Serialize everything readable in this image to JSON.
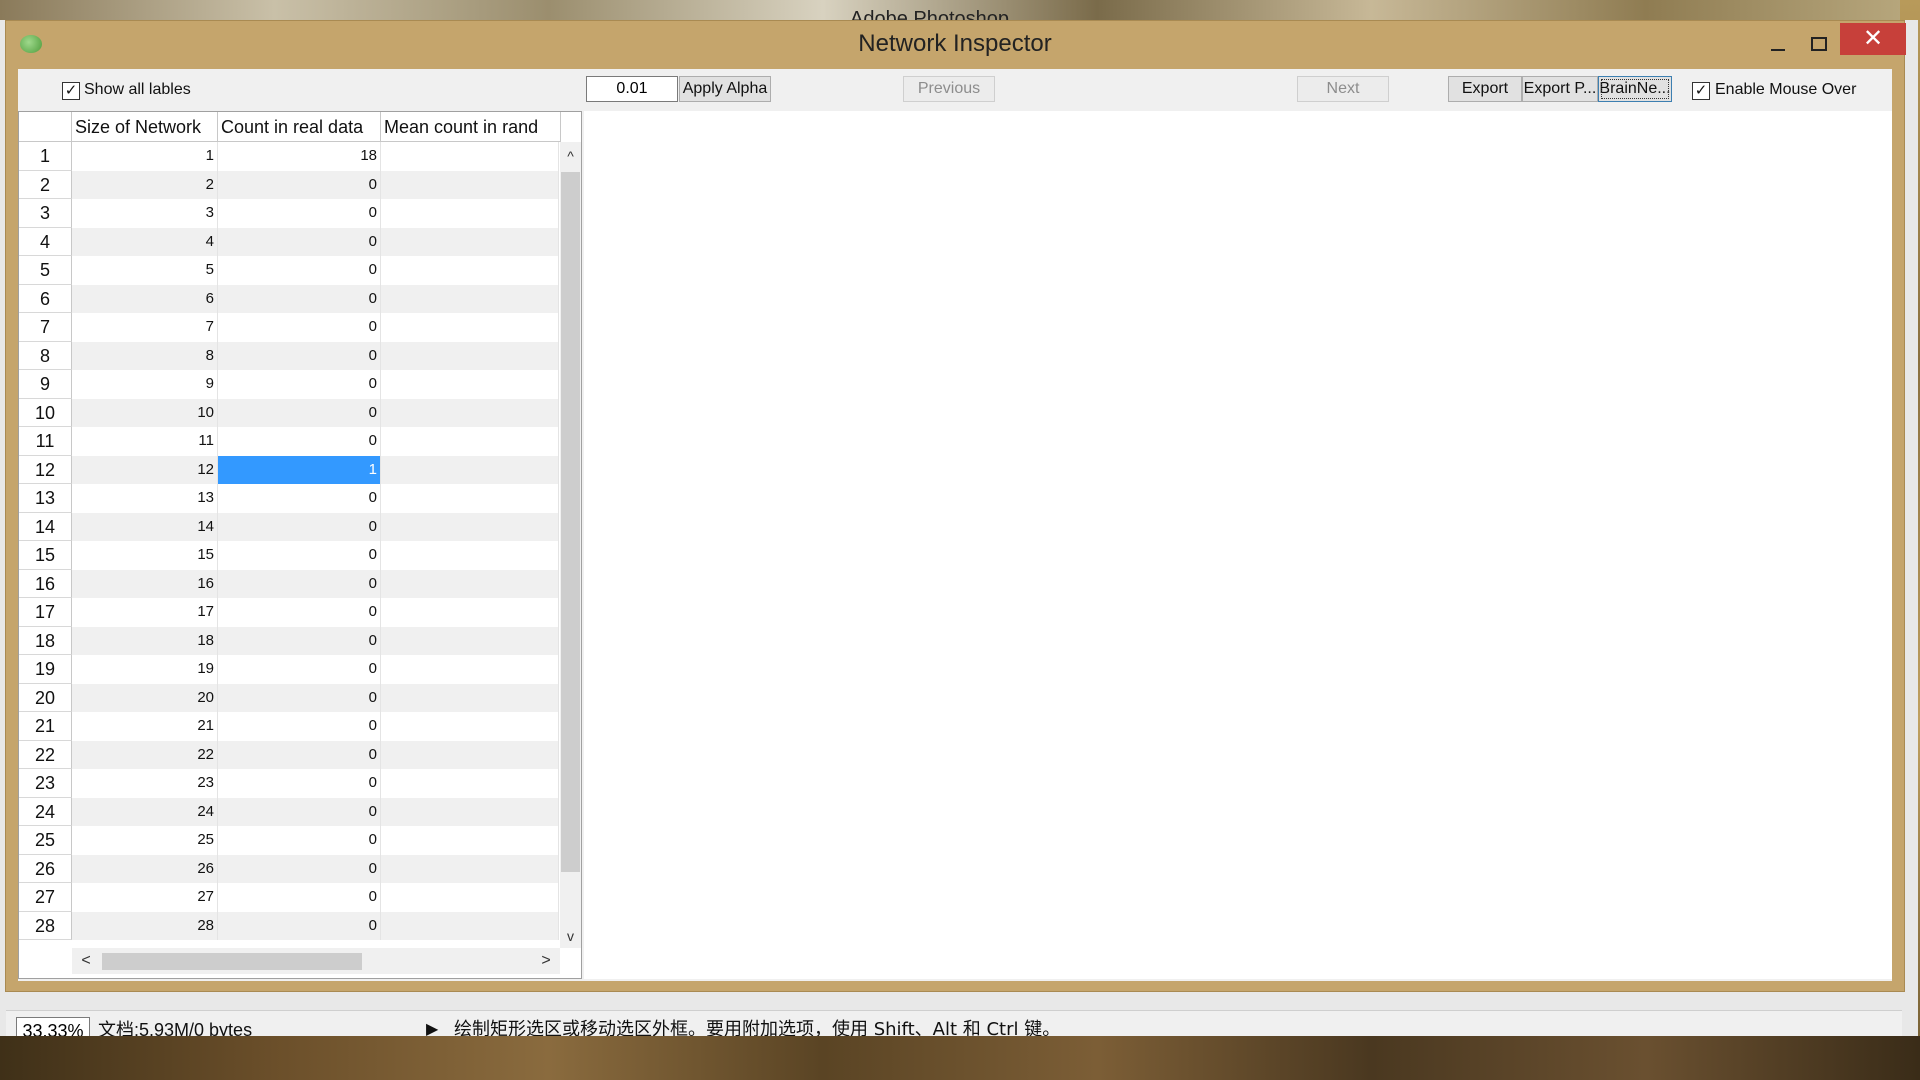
{
  "desktop": {
    "behind_title": "Adobe Photoshop"
  },
  "window": {
    "title": "Network Inspector",
    "close_glyph": "✕"
  },
  "toolbar": {
    "show_all_labels": {
      "label": "Show all lables",
      "checked": true
    },
    "alpha_value": "0.01",
    "apply_alpha": "Apply Alpha",
    "previous": "Previous",
    "next": "Next",
    "export": "Export",
    "export_p": "Export P...",
    "brainnet": "BrainNe...",
    "enable_mouse_over": {
      "label": "Enable Mouse Over",
      "checked": true
    },
    "check_glyph": "✓"
  },
  "table": {
    "columns": [
      "Size of Network",
      "Count in real data",
      "Mean count in rand"
    ],
    "rows": [
      {
        "n": "1",
        "size": "1",
        "count": "18"
      },
      {
        "n": "2",
        "size": "2",
        "count": "0"
      },
      {
        "n": "3",
        "size": "3",
        "count": "0"
      },
      {
        "n": "4",
        "size": "4",
        "count": "0"
      },
      {
        "n": "5",
        "size": "5",
        "count": "0"
      },
      {
        "n": "6",
        "size": "6",
        "count": "0"
      },
      {
        "n": "7",
        "size": "7",
        "count": "0"
      },
      {
        "n": "8",
        "size": "8",
        "count": "0"
      },
      {
        "n": "9",
        "size": "9",
        "count": "0"
      },
      {
        "n": "10",
        "size": "10",
        "count": "0"
      },
      {
        "n": "11",
        "size": "11",
        "count": "0"
      },
      {
        "n": "12",
        "size": "12",
        "count": "1",
        "selected": true
      },
      {
        "n": "13",
        "size": "13",
        "count": "0"
      },
      {
        "n": "14",
        "size": "14",
        "count": "0"
      },
      {
        "n": "15",
        "size": "15",
        "count": "0"
      },
      {
        "n": "16",
        "size": "16",
        "count": "0"
      },
      {
        "n": "17",
        "size": "17",
        "count": "0"
      },
      {
        "n": "18",
        "size": "18",
        "count": "0"
      },
      {
        "n": "19",
        "size": "19",
        "count": "0"
      },
      {
        "n": "20",
        "size": "20",
        "count": "0"
      },
      {
        "n": "21",
        "size": "21",
        "count": "0"
      },
      {
        "n": "22",
        "size": "22",
        "count": "0"
      },
      {
        "n": "23",
        "size": "23",
        "count": "0"
      },
      {
        "n": "24",
        "size": "24",
        "count": "0"
      },
      {
        "n": "25",
        "size": "25",
        "count": "0"
      },
      {
        "n": "26",
        "size": "26",
        "count": "0"
      },
      {
        "n": "27",
        "size": "27",
        "count": "0"
      },
      {
        "n": "28",
        "size": "28",
        "count": "0"
      }
    ],
    "scroll_up": "^",
    "scroll_down": "v",
    "scroll_left": "<",
    "scroll_right": ">"
  },
  "statusbar": {
    "zoom": "33.33%",
    "doc_info": "文档:5.93M/0 bytes",
    "arrow": "▶",
    "hint": "绘制矩形选区或移动选区外框。要用附加选项，使用 Shift、Alt 和 Ctrl 键。"
  },
  "colors": {
    "window_frame": "#c5a56c",
    "selection": "#3399ff",
    "close_button": "#c7403a"
  }
}
